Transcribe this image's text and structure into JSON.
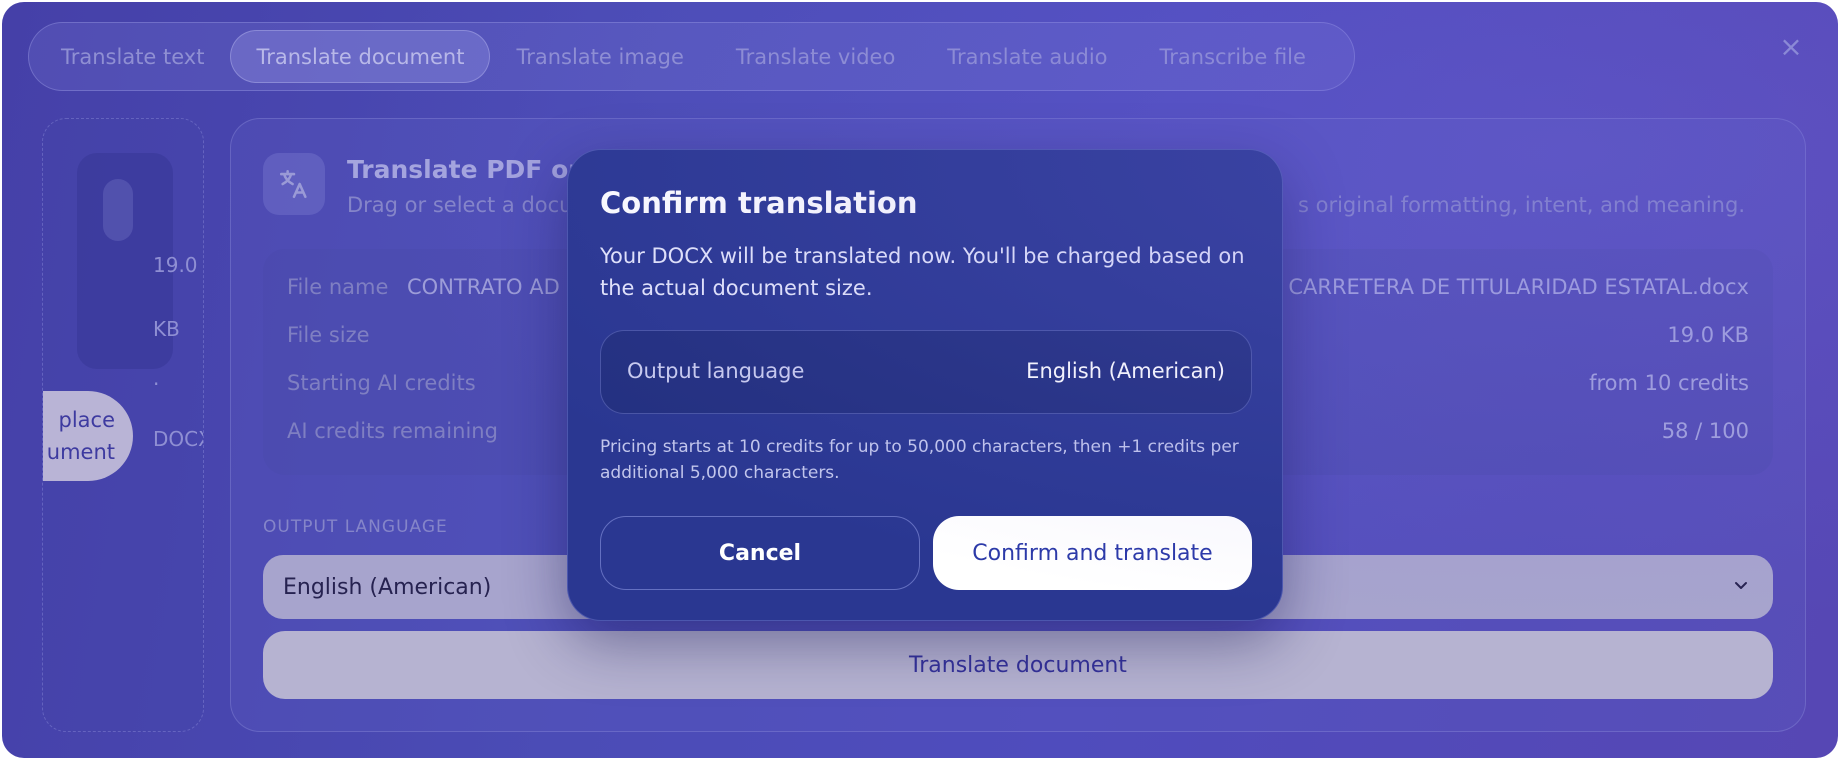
{
  "tabs": [
    {
      "label": "Translate text"
    },
    {
      "label": "Translate document"
    },
    {
      "label": "Translate image"
    },
    {
      "label": "Translate video"
    },
    {
      "label": "Translate audio"
    },
    {
      "label": "Transcribe file"
    }
  ],
  "active_tab": "Translate document",
  "close_icon": "×",
  "file_card": {
    "size_line1": "19.0",
    "size_line2": "KB",
    "dot": "·",
    "type": "DOCX",
    "replace_line1": "place",
    "replace_line2": "ument"
  },
  "main": {
    "title": "Translate PDF or d",
    "subtitle_left": "Drag or select a docu",
    "subtitle_right": "s original formatting, intent, and meaning.",
    "info": {
      "file_name_label": "File name",
      "file_name_value_left": "CONTRATO AD",
      "file_name_value_right": "CARRETERA DE TITULARIDAD ESTATAL.docx",
      "file_size_label": "File size",
      "file_size_value": "19.0 KB",
      "starting_credits_label": "Starting AI credits",
      "starting_credits_value": "from 10 credits",
      "remaining_label": "AI credits remaining",
      "remaining_value": "58 / 100"
    },
    "output_language_section": "OUTPUT LANGUAGE",
    "selected_language": "English (American)",
    "translate_button": "Translate document"
  },
  "modal": {
    "title": "Confirm translation",
    "description": "Your DOCX will be translated now. You'll be charged based on the actual document size.",
    "output_language_label": "Output language",
    "output_language_value": "English (American)",
    "pricing_note": "Pricing starts at 10 credits for up to 50,000 characters, then +1 credits per additional 5,000 characters.",
    "cancel_label": "Cancel",
    "confirm_label": "Confirm and translate"
  },
  "colors": {
    "modal_bg": "#2a3791",
    "confirm_text": "#2b39a8",
    "backdrop": "#4b4cb6"
  }
}
